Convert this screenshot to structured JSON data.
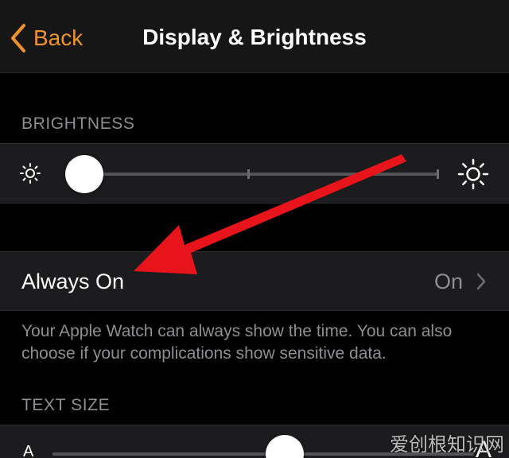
{
  "navbar": {
    "back_label": "Back",
    "title": "Display & Brightness"
  },
  "brightness": {
    "header": "BRIGHTNESS",
    "icon_low": "sun-small-icon",
    "icon_high": "sun-large-icon",
    "level": 0.05
  },
  "always_on": {
    "label": "Always On",
    "value": "On",
    "description": "Your Apple Watch can always show the time. You can also choose if your complications show sensitive data."
  },
  "text_size": {
    "header": "TEXT SIZE",
    "small_glyph": "A",
    "large_glyph": "A",
    "level": 0.55
  },
  "watermark": "爱创根知识网",
  "colors": {
    "accent": "#f0922a",
    "background": "#000000",
    "cell": "#1c1c1e",
    "secondary_text": "#8e8e93",
    "annotation_arrow": "#e8141b"
  }
}
